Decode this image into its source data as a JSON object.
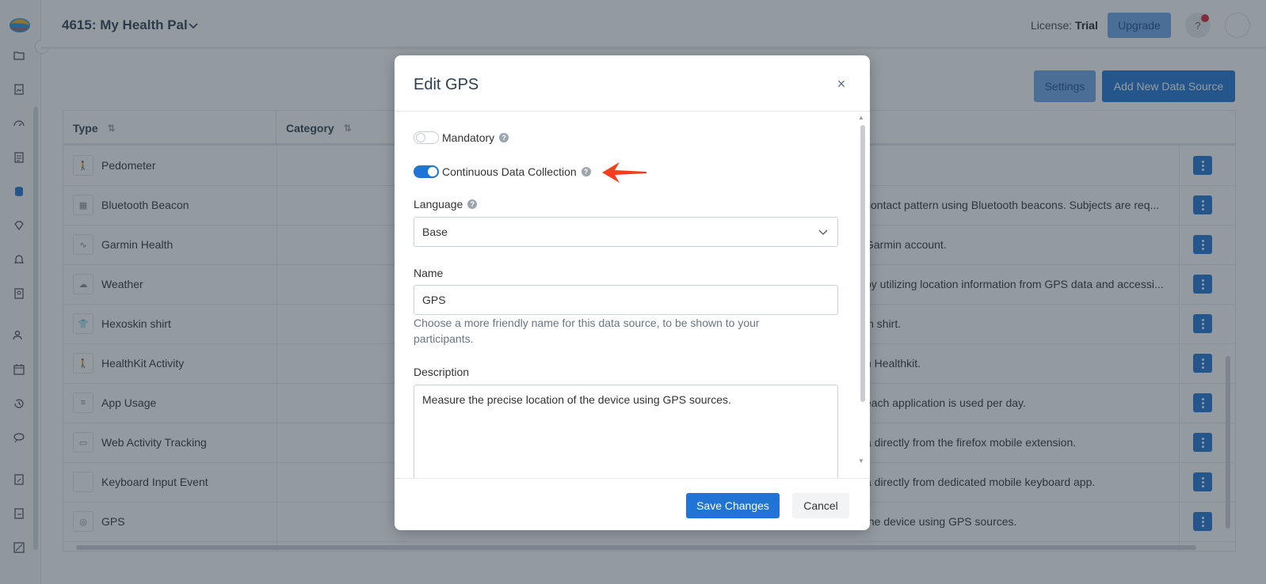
{
  "header": {
    "project_title": "4615: My Health Pal",
    "license_label": "License:",
    "license_value": "Trial",
    "upgrade_label": "Upgrade",
    "help_label": "?"
  },
  "toolbar": {
    "settings_label": "Settings",
    "add_new_label": "Add New Data Source"
  },
  "table": {
    "columns": [
      "Type",
      "Category"
    ],
    "rows": [
      {
        "type": "Pedometer",
        "icon": "walk-icon",
        "desc": ""
      },
      {
        "type": "Bluetooth Beacon",
        "icon": "beacon-icon",
        "desc": "contact pattern using Bluetooth beacons. Subjects are req..."
      },
      {
        "type": "Garmin Health",
        "icon": "waveform-icon",
        "desc": "Garmin account."
      },
      {
        "type": "Weather",
        "icon": "cloud-icon",
        "desc": "by utilizing location information from GPS data and accessi..."
      },
      {
        "type": "Hexoskin shirt",
        "icon": "shirt-icon",
        "desc": "in shirt."
      },
      {
        "type": "HealthKit Activity",
        "icon": "walk-icon",
        "desc": "n Healthkit."
      },
      {
        "type": "App Usage",
        "icon": "list-icon",
        "desc": "each application is used per day."
      },
      {
        "type": "Web Activity Tracking",
        "icon": "browser-icon",
        "desc": "a directly from the firefox mobile extension."
      },
      {
        "type": "Keyboard Input Event",
        "icon": "keyboard-icon",
        "desc": "a directly from dedicated mobile keyboard app."
      },
      {
        "type": "GPS",
        "icon": "target-icon",
        "desc": "the device using GPS sources."
      }
    ]
  },
  "modal": {
    "title": "Edit GPS",
    "close_glyph": "×",
    "mandatory_label": "Mandatory",
    "mandatory_on": false,
    "continuous_label": "Continuous Data Collection",
    "continuous_on": true,
    "language_label": "Language",
    "language_value": "Base",
    "name_label": "Name",
    "name_value": "GPS",
    "name_help": "Choose a more friendly name for this data source, to be shown to your participants.",
    "description_label": "Description",
    "description_value": "Measure the precise location of the device using GPS sources.",
    "save_label": "Save Changes",
    "cancel_label": "Cancel"
  },
  "colors": {
    "primary": "#1f74d6",
    "overlay": "#2a3842",
    "annotation_arrow": "#f2401c"
  }
}
